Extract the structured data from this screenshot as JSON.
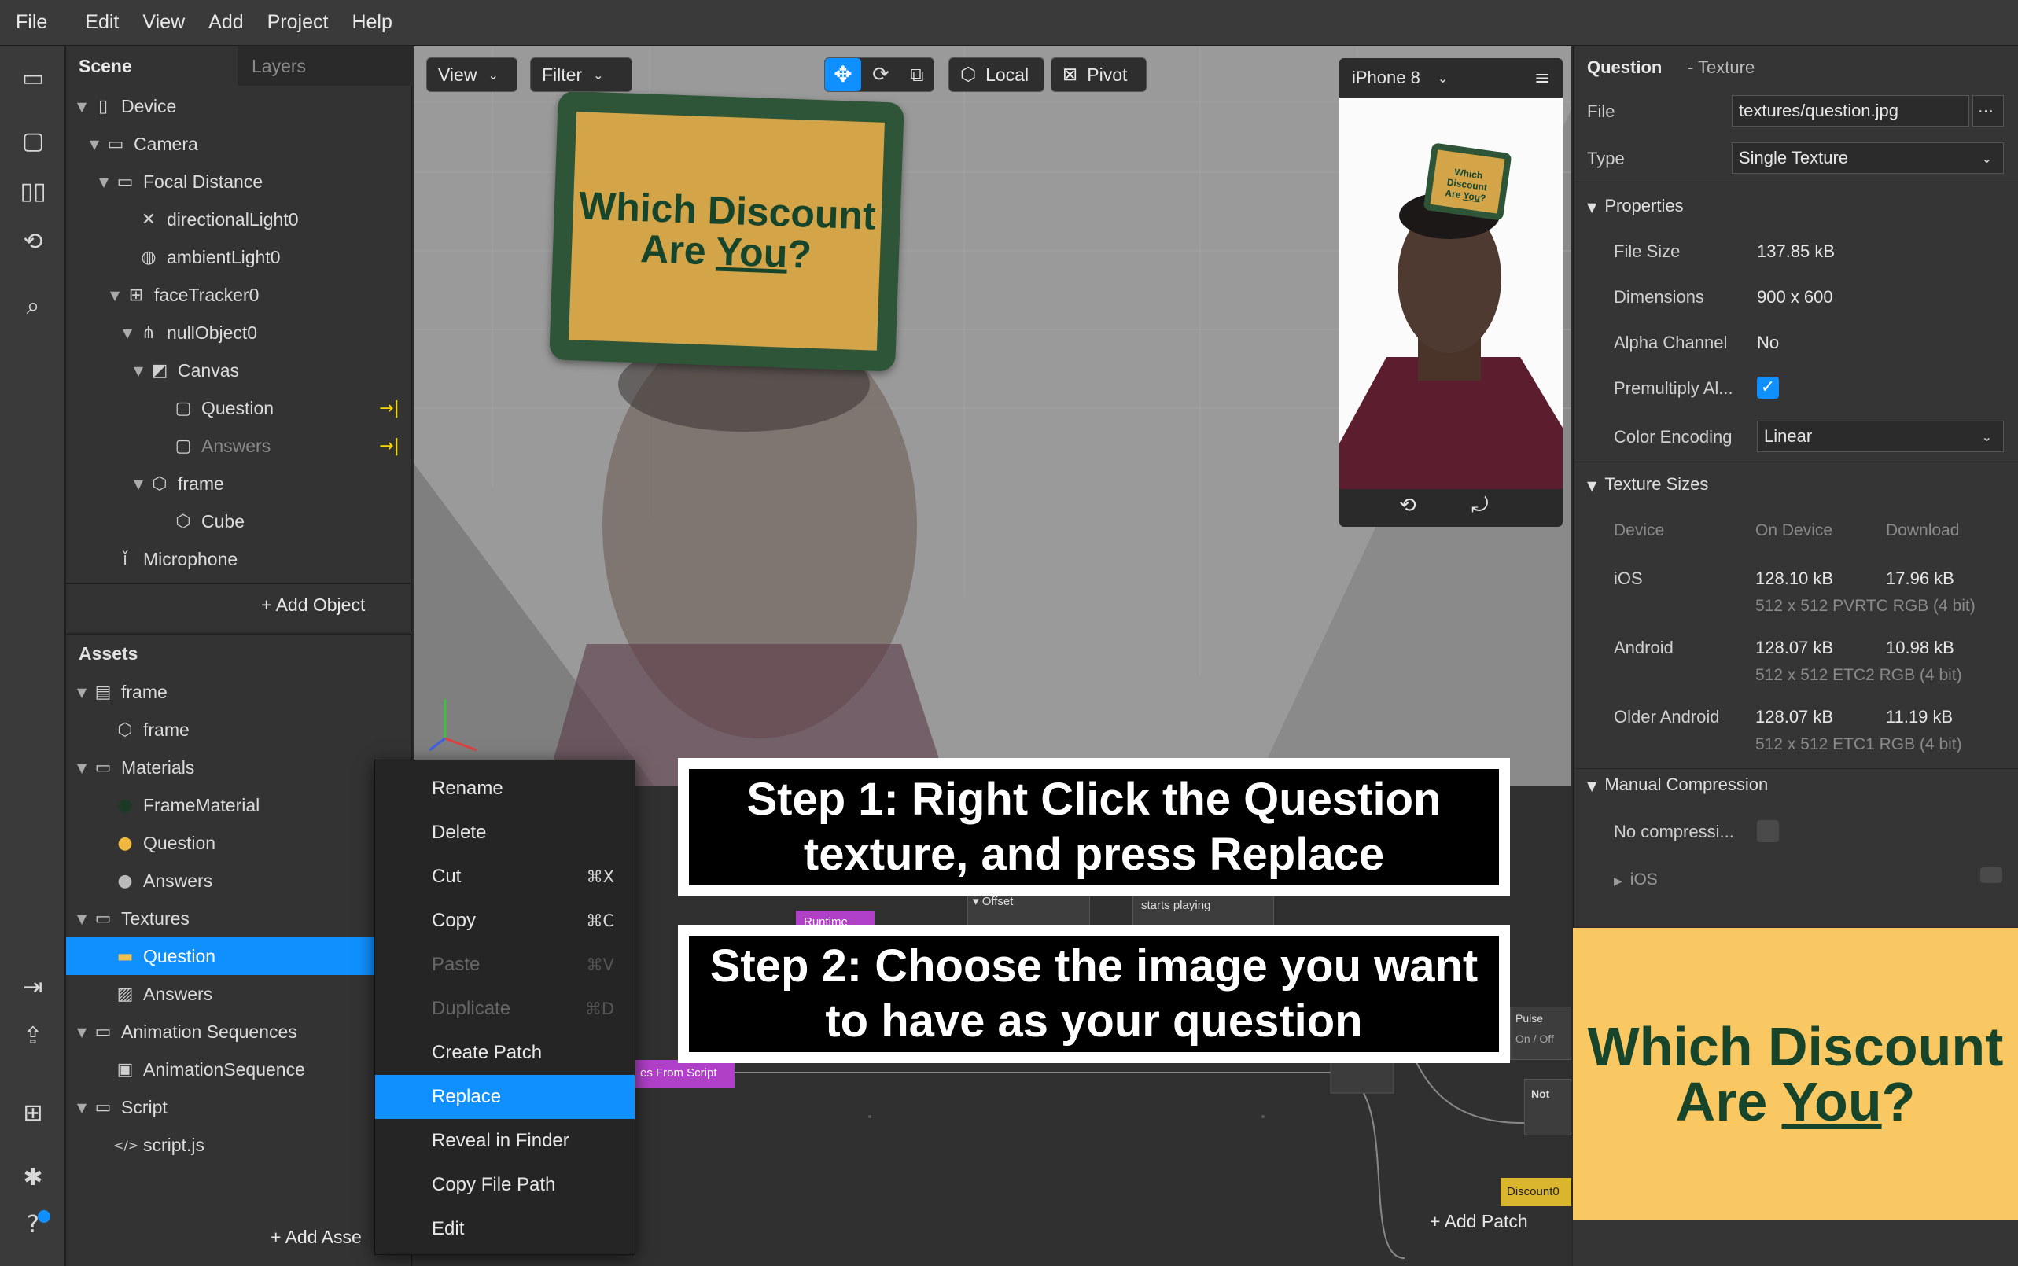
{
  "menu": {
    "items": [
      "File",
      "Edit",
      "View",
      "Add",
      "Project",
      "Help"
    ]
  },
  "scene": {
    "tabs": {
      "scene": "Scene",
      "layers": "Layers"
    },
    "tree": [
      {
        "label": "Device",
        "icon": "device-icon"
      },
      {
        "label": "Camera",
        "icon": "camera-icon"
      },
      {
        "label": "Focal Distance",
        "icon": "focal-distance-icon"
      },
      {
        "label": "directionalLight0",
        "icon": "directional-light-icon"
      },
      {
        "label": "ambientLight0",
        "icon": "ambient-light-icon"
      },
      {
        "label": "faceTracker0",
        "icon": "face-tracker-icon"
      },
      {
        "label": "nullObject0",
        "icon": "null-object-icon"
      },
      {
        "label": "Canvas",
        "icon": "canvas-icon"
      },
      {
        "label": "Question",
        "icon": "rectangle-icon"
      },
      {
        "label": "Answers",
        "icon": "rectangle-icon"
      },
      {
        "label": "frame",
        "icon": "cube-icon"
      },
      {
        "label": "Cube",
        "icon": "cube-icon"
      },
      {
        "label": "Microphone",
        "icon": "microphone-icon"
      }
    ],
    "add_object": "Add Object"
  },
  "assets": {
    "title": "Assets",
    "tree": [
      {
        "label": "frame",
        "icon": "file-icon"
      },
      {
        "label": "frame",
        "icon": "cube-icon"
      },
      {
        "label": "Materials",
        "icon": "folder-icon"
      },
      {
        "label": "FrameMaterial",
        "icon": "material-dark-icon"
      },
      {
        "label": "Question",
        "icon": "material-question-icon"
      },
      {
        "label": "Answers",
        "icon": "material-sphere-icon"
      },
      {
        "label": "Textures",
        "icon": "folder-icon"
      },
      {
        "label": "Question",
        "icon": "texture-thumbnail-icon"
      },
      {
        "label": "Answers",
        "icon": "image-icon"
      },
      {
        "label": "Animation Sequences",
        "icon": "folder-icon"
      },
      {
        "label": "AnimationSequence",
        "icon": "animation-sequence-icon"
      },
      {
        "label": "Script",
        "icon": "folder-icon"
      },
      {
        "label": "script.js",
        "icon": "code-icon"
      }
    ],
    "add_asset": "Add Asse"
  },
  "viewport": {
    "view_label": "View",
    "filter_label": "Filter",
    "local_label": "Local",
    "pivot_label": "Pivot",
    "sign_line1": "Which Discount",
    "sign_line2_a": "Are ",
    "sign_line2_b": "You",
    "sign_line2_c": "?",
    "device_name": "iPhone 8"
  },
  "patch": {
    "nodes": {
      "offset": "Offset",
      "starts_playing": "starts playing",
      "runtime": "Runtime",
      "from_script": "es From Script",
      "pulse": "Pulse",
      "on_off": "On / Off",
      "not": "Not",
      "discount": "Discount0"
    },
    "add_patch": "Add Patch"
  },
  "inspector": {
    "title": "Question",
    "subtitle": "- Texture",
    "file_label": "File",
    "file_value": "textures/question.jpg",
    "file_more": "···",
    "type_label": "Type",
    "type_value": "Single Texture",
    "properties": "Properties",
    "file_size_label": "File Size",
    "file_size_value": "137.85 kB",
    "dimensions_label": "Dimensions",
    "dimensions_value": "900 x 600",
    "alpha_label": "Alpha Channel",
    "alpha_value": "No",
    "premult_label": "Premultiply Al...",
    "premult_checked": true,
    "color_enc_label": "Color Encoding",
    "color_enc_value": "Linear",
    "texture_sizes": "Texture Sizes",
    "col_device": "Device",
    "col_on_device": "On Device",
    "col_download": "Download",
    "rows": [
      {
        "device": "iOS",
        "on_device": "128.10 kB",
        "download": "17.96 kB",
        "detail": "512 x 512 PVRTC RGB (4 bit)"
      },
      {
        "device": "Android",
        "on_device": "128.07 kB",
        "download": "10.98 kB",
        "detail": "512 x 512 ETC2 RGB (4 bit)"
      },
      {
        "device": "Older Android",
        "on_device": "128.07 kB",
        "download": "11.19 kB",
        "detail": "512 x 512 ETC1 RGB (4 bit)"
      }
    ],
    "manual_compression": "Manual Compression",
    "no_compression_label": "No compressi...",
    "ios_partial": "iOS"
  },
  "texture_preview": {
    "line1": "Which Discount",
    "line2_a": "Are ",
    "line2_b": "You",
    "line2_c": "?"
  },
  "context_menu": {
    "items": [
      {
        "label": "Rename",
        "shortcut": "",
        "disabled": false
      },
      {
        "label": "Delete",
        "shortcut": "",
        "disabled": false
      },
      {
        "label": "Cut",
        "shortcut": "⌘X",
        "disabled": false
      },
      {
        "label": "Copy",
        "shortcut": "⌘C",
        "disabled": false
      },
      {
        "label": "Paste",
        "shortcut": "⌘V",
        "disabled": true
      },
      {
        "label": "Duplicate",
        "shortcut": "⌘D",
        "disabled": true
      },
      {
        "label": "Create Patch",
        "shortcut": "",
        "disabled": false
      },
      {
        "label": "Replace",
        "shortcut": "",
        "disabled": false
      },
      {
        "label": "Reveal in Finder",
        "shortcut": "",
        "disabled": false
      },
      {
        "label": "Copy File Path",
        "shortcut": "",
        "disabled": false
      },
      {
        "label": "Edit",
        "shortcut": "",
        "disabled": false
      }
    ]
  },
  "steps": {
    "step1_line1": "Step 1: Right Click the Question",
    "step1_line2": "texture, and press Replace",
    "step2_line1": "Step 2: Choose the image you want",
    "step2_line2": "to have as your question"
  },
  "colors": {
    "accent": "#1090ff",
    "sign_yellow": "#d4a548",
    "sign_green": "#2f5538",
    "texture_yellow": "#fac863",
    "text_green": "#16452c"
  }
}
